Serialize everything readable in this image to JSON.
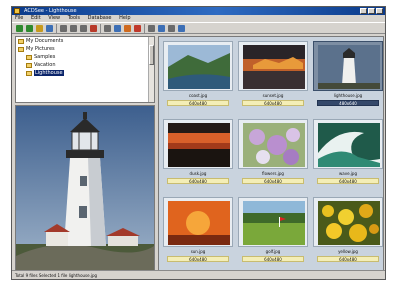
{
  "window": {
    "title": "ACDSee - Lighthouse"
  },
  "menu": {
    "items": [
      "File",
      "Edit",
      "View",
      "Tools",
      "Database",
      "Help"
    ]
  },
  "toolbar": {
    "buttons": [
      {
        "icon": "back-icon",
        "color": "#2f8a2f"
      },
      {
        "icon": "forward-icon",
        "color": "#2f8a2f"
      },
      {
        "icon": "up-icon",
        "color": "#c79a1e"
      },
      {
        "icon": "refresh-icon",
        "color": "#3d6fb5"
      },
      {
        "icon": "view-icon",
        "color": "#6b6b6b"
      },
      {
        "icon": "copy-icon",
        "color": "#6b6b6b"
      },
      {
        "icon": "move-icon",
        "color": "#6b6b6b"
      },
      {
        "icon": "delete-icon",
        "color": "#b83a2a"
      },
      {
        "icon": "rename-icon",
        "color": "#6b6b6b"
      },
      {
        "icon": "rotate-icon",
        "color": "#3d6fb5"
      },
      {
        "icon": "edit-icon",
        "color": "#d06a1e"
      },
      {
        "icon": "slideshow-icon",
        "color": "#c0392b"
      },
      {
        "icon": "print-icon",
        "color": "#6b6b6b"
      },
      {
        "icon": "email-icon",
        "color": "#3d6fb5"
      },
      {
        "icon": "wallpaper-icon",
        "color": "#6b6b6b"
      },
      {
        "icon": "help-icon",
        "color": "#3d6fb5"
      }
    ]
  },
  "tree": {
    "items": [
      {
        "label": "My Documents",
        "selected": false
      },
      {
        "label": "My Pictures",
        "selected": false
      },
      {
        "label": "Samples",
        "selected": false
      },
      {
        "label": "Vacation",
        "selected": false
      },
      {
        "label": "Lighthouse",
        "selected": true
      }
    ]
  },
  "thumbnails": [
    {
      "name": "coast.jpg",
      "info": "640x480",
      "scene": "coast",
      "selected": false
    },
    {
      "name": "sunset.jpg",
      "info": "640x480",
      "scene": "sunset-fire",
      "selected": false
    },
    {
      "name": "lighthouse.jpg",
      "info": "480x640",
      "scene": "lighthouse",
      "selected": true
    },
    {
      "name": "dusk.jpg",
      "info": "640x480",
      "scene": "sunset-orange",
      "selected": false
    },
    {
      "name": "flowers.jpg",
      "info": "640x480",
      "scene": "flowers",
      "selected": false
    },
    {
      "name": "wave.jpg",
      "info": "640x480",
      "scene": "wave",
      "selected": false
    },
    {
      "name": "sun.jpg",
      "info": "640x480",
      "scene": "sun",
      "selected": false
    },
    {
      "name": "golf.jpg",
      "info": "640x480",
      "scene": "golf",
      "selected": false
    },
    {
      "name": "yellow.jpg",
      "info": "640x480",
      "scene": "yellow-flowers",
      "selected": false
    }
  ],
  "status": {
    "text": "Total 9 files   Selected 1 file   lighthouse.jpg"
  }
}
